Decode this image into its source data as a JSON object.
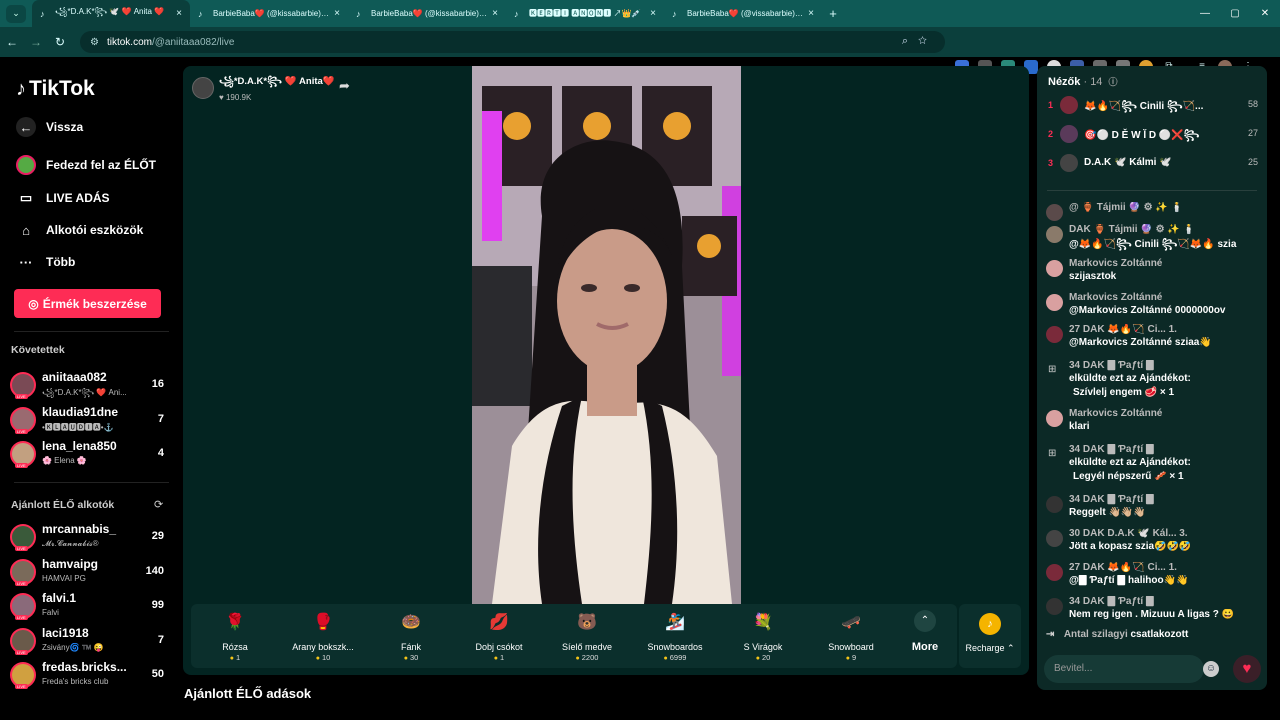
{
  "browser": {
    "tabs": [
      {
        "title": "꧁*D.A.K*꧂ 🕊️ ❤️ Anita ❤️",
        "active": true
      },
      {
        "title": "BarbieBaba❤️ (@kissabarbie) | TikTok",
        "active": false
      },
      {
        "title": "BarbieBaba❤️ (@kissabarbie) | TikTok",
        "active": false
      },
      {
        "title": "🅺🅴🆁🆃🅸 🅰🅽🅾🅽🅸 ↗👑💉",
        "active": false
      },
      {
        "title": "BarbieBaba❤️ (@vissabarbie) | TikTok",
        "active": false
      }
    ],
    "url_host": "tiktok.com",
    "url_path": "/@aniitaaa082/live"
  },
  "sidebar": {
    "logo": "TikTok",
    "back": "Vissza",
    "explore_live": "Fedezd fel az ÉLŐT",
    "live_broadcast": "LIVE ADÁS",
    "creator_tools": "Alkotói eszközök",
    "more": "Több",
    "coins_button": "Érmék beszerzése",
    "following_title": "Követettek",
    "following": [
      {
        "name": "aniitaaa082",
        "sub": "꧁*D.A.K*꧂ ❤️ Ani...",
        "count": "16",
        "color": "#7a4a55"
      },
      {
        "name": "klaudia91dne",
        "sub": "•🅺🅻🅰🆄🅳🅸🅰•⚓",
        "count": "7",
        "color": "#9a6a70"
      },
      {
        "name": "lena_lena850",
        "sub": "🌸 Elena 🌸",
        "count": "4",
        "color": "#c2a080"
      }
    ],
    "recommended_title": "Ajánlott ÉLŐ alkotók",
    "recommended": [
      {
        "name": "mrcannabis_",
        "sub": "𝓜𝓻.𝓒𝓪𝓷𝓷𝓪𝓫𝓲𝓼®",
        "count": "29",
        "color": "#3a5a3a"
      },
      {
        "name": "hamvaipg",
        "sub": "HAMVAI PG",
        "count": "140",
        "color": "#7a6a5a"
      },
      {
        "name": "falvi.1",
        "sub": "Falvi",
        "count": "99",
        "color": "#8a6a7a"
      },
      {
        "name": "laci1918",
        "sub": "Zsivány🌀 ™️ 😜",
        "count": "7",
        "color": "#6a5a4a"
      },
      {
        "name": "fredas.bricks...",
        "sub": "Freda's bricks club",
        "count": "50",
        "color": "#d0a040"
      }
    ]
  },
  "stage": {
    "host_name": "꧁*D.A.K*꧂ ❤️ Anita❤️",
    "host_likes": "♥ 190.9K",
    "gifts": [
      {
        "name": "Rózsa",
        "price": "1",
        "icon": "🌹"
      },
      {
        "name": "Arany bokszk...",
        "price": "10",
        "icon": "🥊"
      },
      {
        "name": "Fánk",
        "price": "30",
        "icon": "🍩"
      },
      {
        "name": "Dobj csókot",
        "price": "1",
        "icon": "💋"
      },
      {
        "name": "Síelő medve",
        "price": "2200",
        "icon": "🐻"
      },
      {
        "name": "Snowboardos",
        "price": "6999",
        "icon": "🏂"
      },
      {
        "name": "S Virágok",
        "price": "20",
        "icon": "💐"
      },
      {
        "name": "Snowboard",
        "price": "9",
        "icon": "🛹"
      }
    ],
    "more_label": "More",
    "recharge_label": "Recharge ⌃",
    "recommended_streams": "Ajánlott ÉLŐ adások"
  },
  "chat": {
    "viewers_label": "Nézők",
    "viewers_count": "· 14",
    "top_viewers": [
      {
        "rank": "1",
        "name": "🦊🔥🏹꧂ Cinili ꧂🏹...",
        "score": "58",
        "color": "#7a2a3a"
      },
      {
        "rank": "2",
        "name": "🎯⚪ D Ě W Ĭ D ⚪❌꧂",
        "score": "27",
        "color": "#5a3a5a"
      },
      {
        "rank": "3",
        "name": "D.A.K 🕊️ Kálmi 🕊️",
        "score": "25",
        "color": "#444"
      }
    ],
    "messages": [
      {
        "head": "@ 🏺 Tájmii 🔮 ⚙ ✨ 🕯️",
        "body": "",
        "avatar": "#5a4a4a"
      },
      {
        "head": "DAK 🏺 Tájmii 🔮 ⚙ ✨ 🕯️",
        "body": "@🦊🔥🏹꧂ Cinili ꧂🏹🦊🔥 szia",
        "avatar": "#8a7a6a"
      },
      {
        "head": "Markovics Zoltánné",
        "body": "szijasztok",
        "avatar": "#d9a0a0"
      },
      {
        "head": "Markovics Zoltánné",
        "body": "@Markovics Zoltánné 0000000ov",
        "avatar": "#d9a0a0"
      },
      {
        "head": "27 DAK 🦊🔥🏹 Ci... 1.",
        "body": "@Markovics Zoltánné sziaa👋",
        "avatar": "#7a2a3a"
      },
      {
        "head": "34 DAK 🀫 Ƥaƒtí 🀫",
        "body": "elküldte ezt az Ajándékot:",
        "body2": "Szívlelj engem 🥩 × 1",
        "gift": true
      },
      {
        "head": "Markovics Zoltánné",
        "body": "klari",
        "avatar": "#d9a0a0"
      },
      {
        "head": "34 DAK 🀫 Ƥaƒtí 🀫",
        "body": "elküldte ezt az Ajándékot:",
        "body2": "Legyél népszerű 🥓 × 1",
        "gift": true
      },
      {
        "head": "34 DAK 🀫 Ƥaƒtí 🀫",
        "body": "Reggelt 👋🏼👋🏼👋🏼",
        "avatar": "#333"
      },
      {
        "head": "30 DAK D.A.K 🕊️ Kál... 3.",
        "body": "Jött a kopasz szia🤣🤣🤣",
        "avatar": "#444"
      },
      {
        "head": "27 DAK 🦊🔥🏹 Ci... 1.",
        "body": "@🀫 Ƥaƒtí 🀫 halihoo👋👋",
        "avatar": "#7a2a3a"
      },
      {
        "head": "34 DAK 🀫 Ƥaƒtí 🀫",
        "body": "Nem reg igen . Mizuuu A ligas ? 😀",
        "avatar": "#333"
      }
    ],
    "joined_name": "Antal szilagyi",
    "joined_text": "csatlakozott",
    "input_placeholder": "Bevitel..."
  }
}
